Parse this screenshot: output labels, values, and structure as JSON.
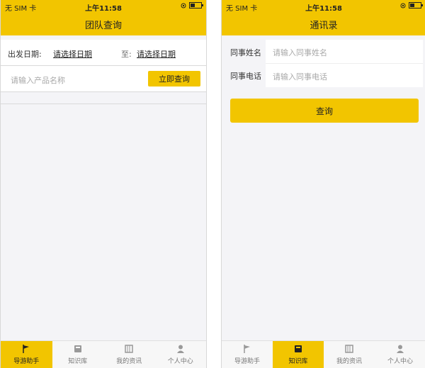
{
  "status": {
    "carrier": "无 SIM 卡",
    "time": "上午11:58"
  },
  "team_query": {
    "title": "团队查询",
    "depart_label": "出发日期:",
    "start_date": "请选择日期",
    "to_label": "至:",
    "end_date": "请选择日期",
    "product_placeholder": "请输入产品名称",
    "query_button": "立即查询"
  },
  "contacts": {
    "title": "通讯录",
    "name_label": "同事姓名",
    "name_placeholder": "请输入同事姓名",
    "phone_label": "同事电话",
    "phone_placeholder": "请输入同事电话",
    "search_button": "查询"
  },
  "tabs": [
    {
      "label": "导游助手",
      "icon": "flag-icon"
    },
    {
      "label": "知识库",
      "icon": "book-icon"
    },
    {
      "label": "我的资讯",
      "icon": "news-icon"
    },
    {
      "label": "个人中心",
      "icon": "person-icon"
    }
  ],
  "colors": {
    "accent": "#f2c500",
    "background": "#f4f4f7"
  },
  "active_tab_left": 0,
  "active_tab_right": 1
}
